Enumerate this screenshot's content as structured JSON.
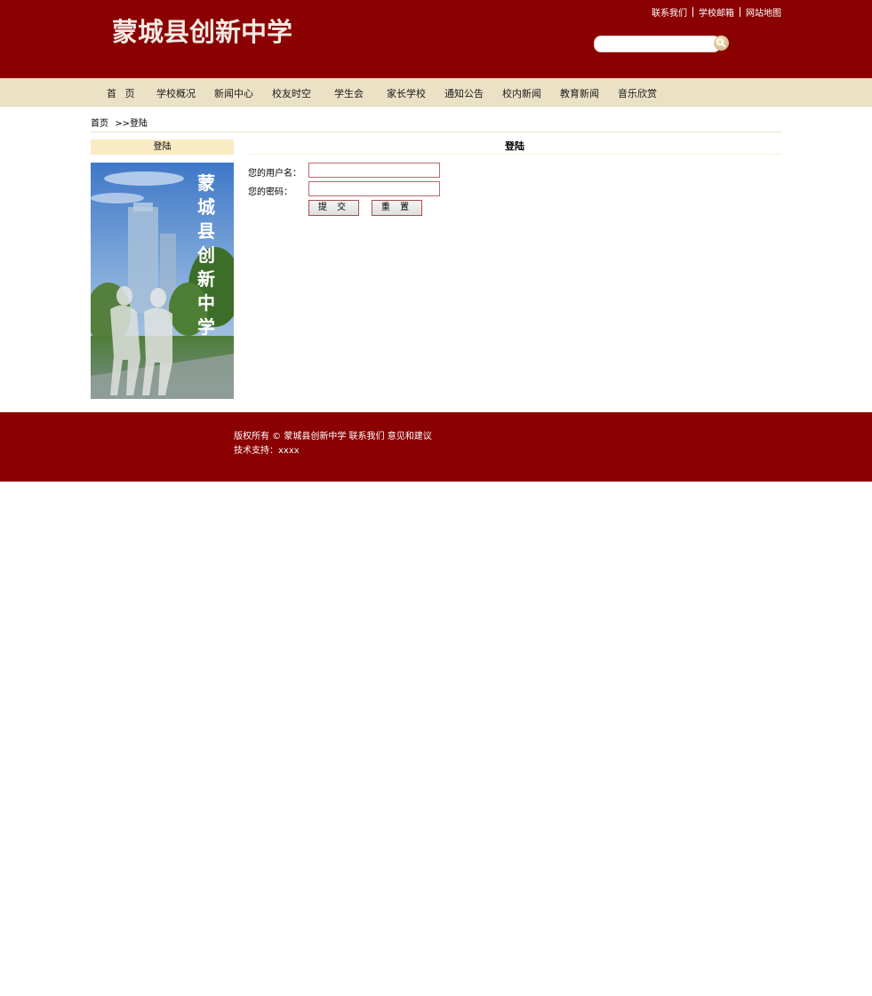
{
  "header": {
    "logo_text": "蒙城县创新中学",
    "top_links": [
      "联系我们",
      "学校邮箱",
      "网站地图"
    ],
    "search_placeholder": ""
  },
  "nav": {
    "items": [
      "首  页",
      "学校概况",
      "新闻中心",
      "校友时空",
      "学生会",
      "家长学校",
      "通知公告",
      "校内新闻",
      "教育新闻",
      "音乐欣赏"
    ]
  },
  "breadcrumb": {
    "home": "首页",
    "separator": ">>",
    "current": "登陆"
  },
  "sidebar": {
    "title": "登陆",
    "image_caption": "蒙城县创新中学"
  },
  "login": {
    "title": "登陆",
    "username_label": "您的用户名：",
    "username_value": "",
    "password_label": "您的密码：",
    "password_value": "",
    "submit_label": "提 交",
    "reset_label": "重 置"
  },
  "footer": {
    "copyright": "版权所有 © 蒙城县创新中学",
    "contact_link": "联系我们",
    "feedback_link": "意见和建议",
    "support": "技术支持：xxxx"
  },
  "colors": {
    "brand_red": "#8b0000",
    "nav_bg": "#ebe2c6",
    "side_head_bg": "#f9ecc4"
  }
}
